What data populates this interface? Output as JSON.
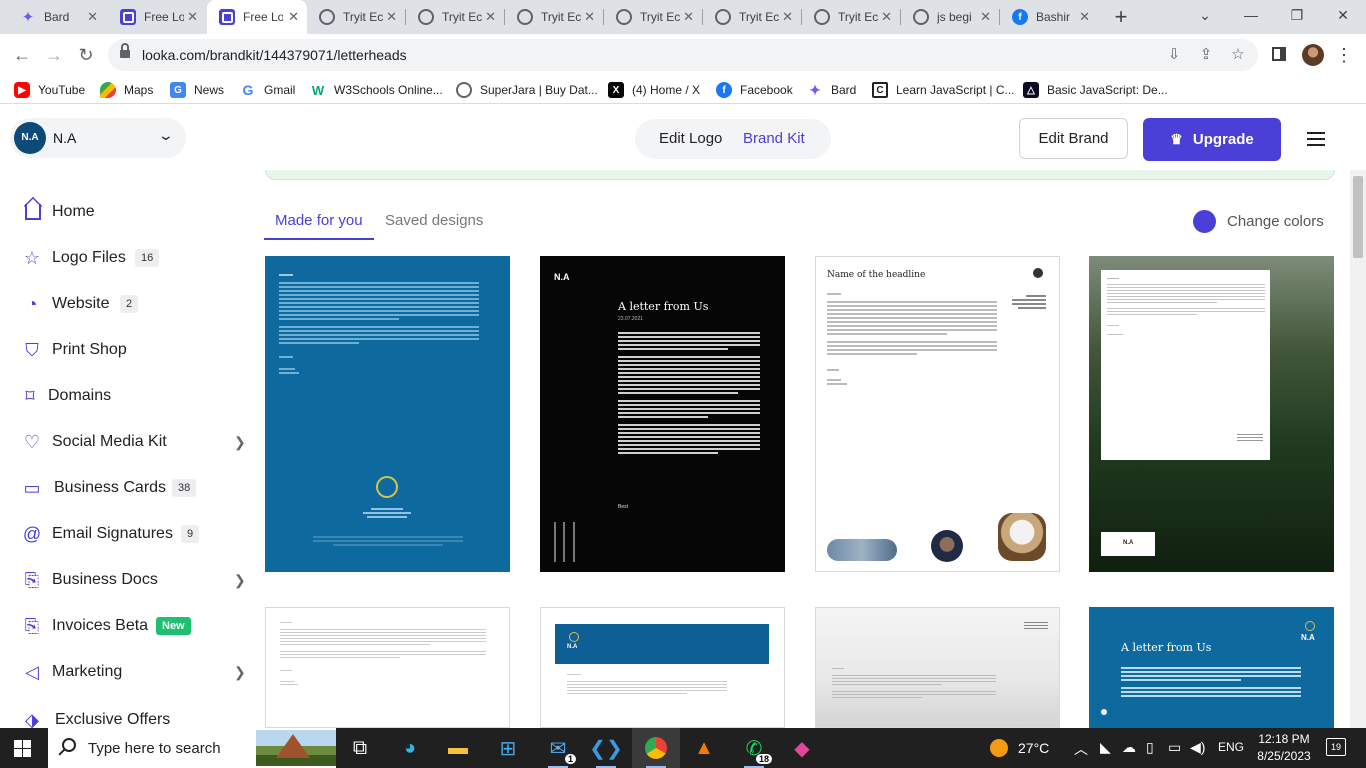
{
  "browser": {
    "tabs": [
      {
        "title": "Bard",
        "icon": "bard-icon"
      },
      {
        "title": "Free Lo",
        "icon": "looka-icon"
      },
      {
        "title": "Free Lo",
        "icon": "looka-icon",
        "active": true
      },
      {
        "title": "Tryit Ec",
        "icon": "globe-icon"
      },
      {
        "title": "Tryit Ec",
        "icon": "globe-icon"
      },
      {
        "title": "Tryit Ec",
        "icon": "globe-icon"
      },
      {
        "title": "Tryit Ec",
        "icon": "globe-icon"
      },
      {
        "title": "Tryit Ec",
        "icon": "globe-icon"
      },
      {
        "title": "Tryit Ec",
        "icon": "globe-icon"
      },
      {
        "title": "js begi",
        "icon": "globe-icon"
      },
      {
        "title": "Bashir",
        "icon": "facebook-icon"
      }
    ],
    "url": "looka.com/brandkit/144379071/letterheads",
    "bookmarks": [
      {
        "label": "YouTube"
      },
      {
        "label": "Maps"
      },
      {
        "label": "News"
      },
      {
        "label": "Gmail"
      },
      {
        "label": "W3Schools Online..."
      },
      {
        "label": "SuperJara | Buy Dat..."
      },
      {
        "label": "(4) Home / X"
      },
      {
        "label": "Facebook"
      },
      {
        "label": "Bard"
      },
      {
        "label": "Learn JavaScript | C..."
      },
      {
        "label": "Basic JavaScript: De..."
      }
    ]
  },
  "header": {
    "brand_logo_text": "N.A",
    "brand_name": "N.A",
    "tab_edit_logo": "Edit Logo",
    "tab_brand_kit": "Brand Kit",
    "edit_brand": "Edit Brand",
    "upgrade": "Upgrade",
    "accent_color": "#4a3fd6"
  },
  "sidebar": {
    "items": [
      {
        "label": "Home",
        "icon": "home-icon"
      },
      {
        "label": "Logo Files",
        "badge": "16",
        "icon": "star-icon"
      },
      {
        "label": "Website",
        "badge": "2",
        "icon": "website-icon"
      },
      {
        "label": "Print Shop",
        "icon": "print-shop-icon"
      },
      {
        "label": "Domains",
        "icon": "bookmark-icon"
      },
      {
        "label": "Social Media Kit",
        "icon": "heart-icon",
        "chevron": true
      },
      {
        "label": "Business Cards",
        "badge": "38",
        "icon": "cards-icon"
      },
      {
        "label": "Email Signatures",
        "badge": "9",
        "icon": "at-icon"
      },
      {
        "label": "Business Docs",
        "icon": "docs-icon",
        "chevron": true
      },
      {
        "label": "Invoices Beta",
        "badge": "New",
        "icon": "invoice-icon"
      },
      {
        "label": "Marketing",
        "icon": "megaphone-icon",
        "chevron": true
      },
      {
        "label": "Exclusive Offers",
        "icon": "tag-icon"
      }
    ]
  },
  "main": {
    "tab_made": "Made for you",
    "tab_saved": "Saved designs",
    "change_colors": "Change colors",
    "card_texts": {
      "a_letter_from_us": "A letter from Us",
      "date": "23.07.2021",
      "name_of_headline": "Name of the headline",
      "best": "Best",
      "logo": "N.A"
    }
  },
  "taskbar": {
    "search_placeholder": "Type here to search",
    "weather": "27°C",
    "lang": "ENG",
    "time": "12:18 PM",
    "date": "8/25/2023",
    "notifications": "19",
    "mail_badge": "1",
    "whatsapp_badge": "18"
  }
}
